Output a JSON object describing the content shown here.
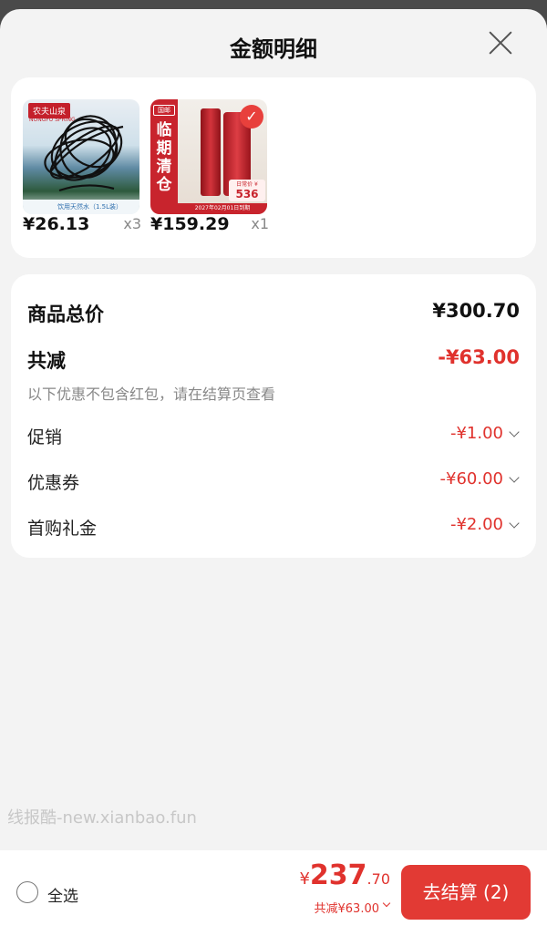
{
  "sheet": {
    "title": "金额明细"
  },
  "products": [
    {
      "price": "¥26.13",
      "qty": "x3",
      "thumb_brand": "农夫山泉",
      "thumb_brand_sub": "NONGFU SPRING",
      "thumb_caption": "饮用天然水（1.5L装）"
    },
    {
      "price": "¥159.29",
      "qty": "x1",
      "thumb_tag": "国邮",
      "thumb_text": "临期清仓",
      "thumb_date": "2027年02月01日到期",
      "thumb_side_label": "日常价 ¥",
      "thumb_side_price": "536"
    }
  ],
  "summary": {
    "total_label": "商品总价",
    "total_value": "¥300.70",
    "reduce_label": "共减",
    "reduce_value": "-¥63.00",
    "note": "以下优惠不包含红包，请在结算页查看",
    "items": [
      {
        "label": "促销",
        "value": "-¥1.00"
      },
      {
        "label": "优惠券",
        "value": "-¥60.00"
      },
      {
        "label": "首购礼金",
        "value": "-¥2.00"
      }
    ]
  },
  "watermark": "线报酷-new.xianbao.fun",
  "bottom_bar": {
    "select_all_label": "全选",
    "currency": "¥",
    "price_int": "237",
    "price_dec": ".70",
    "saved_text": "共减¥63.00",
    "checkout_label": "去结算 (2)"
  },
  "colors": {
    "accent_red": "#e0322d",
    "button_red": "#e23a34",
    "sheet_bg": "#f3f3f3"
  },
  "icons": [
    "close-icon",
    "chevron-down-icon",
    "checkmark-icon",
    "radio-circle-icon"
  ]
}
